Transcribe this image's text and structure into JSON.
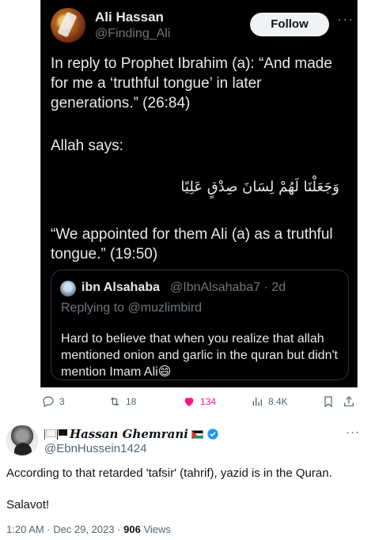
{
  "embedded_tweet": {
    "author_name": "Ali Hassan",
    "author_handle": "@Finding_Ali",
    "follow_label": "Follow",
    "more_label": "···",
    "paragraph1": "In reply to Prophet Ibrahim (a): “And made for me a ‘truthful tongue’ in later generations.” (26:84)",
    "paragraph2": "Allah says:",
    "arabic": "وَجَعَلْنَا لَهُمْ لِسَانَ صِدْقٍ عَلِيًا",
    "paragraph3": "“We appointed for them Ali (a) as a truthful tongue.” (19:50)",
    "quoted": {
      "author_name": "ibn Alsahaba",
      "author_handle": "@IbnAlsahaba7 · 2d",
      "replying_to": "Replying to @muzlimbird",
      "text": "Hard to believe that when you realize that allah mentioned onion and garlic in the quran but didn't mention Imam Ali😄"
    },
    "actions": {
      "replies": "3",
      "retweets": "18",
      "likes": "134",
      "views": "8.4K"
    }
  },
  "post": {
    "author_name": "Hassan Ghemrani",
    "author_handle": "@EbnHussein1424",
    "more_label": "···",
    "text": "According to that retarded 'tafsir' (tahrif), yazid is  in the Quran.",
    "text2": "Salavot!",
    "meta_time": "1:20 AM · Dec 29, 2023 · ",
    "views_count": "906",
    "views_label": " Views"
  },
  "colors": {
    "dark_bg": "#000000",
    "like_pink": "#f91880",
    "verified_blue": "#1d9bf0"
  }
}
